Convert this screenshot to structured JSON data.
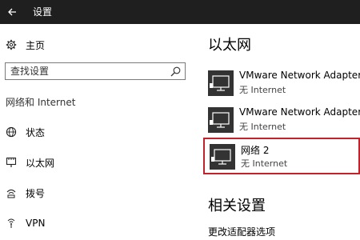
{
  "window": {
    "title": "设置"
  },
  "sidebar": {
    "home_label": "主页",
    "search_placeholder": "查找设置",
    "section_label": "网络和 Internet",
    "items": [
      {
        "label": "状态",
        "icon": "globe-icon"
      },
      {
        "label": "以太网",
        "icon": "ethernet-icon"
      },
      {
        "label": "拨号",
        "icon": "dialup-icon"
      },
      {
        "label": "VPN",
        "icon": "vpn-icon"
      }
    ]
  },
  "main": {
    "title": "以太网",
    "adapters": [
      {
        "name": "VMware Network Adapter V",
        "status": "无 Internet",
        "selected": false
      },
      {
        "name": "VMware Network Adapter V",
        "status": "无 Internet",
        "selected": false
      },
      {
        "name": "网络  2",
        "status": "无 Internet",
        "selected": true
      }
    ],
    "related_title": "相关设置",
    "related_link": "更改适配器选项"
  },
  "colors": {
    "titlebar": "#1f1f1f",
    "highlight": "#c0232b",
    "icon_dark": "#333333"
  }
}
